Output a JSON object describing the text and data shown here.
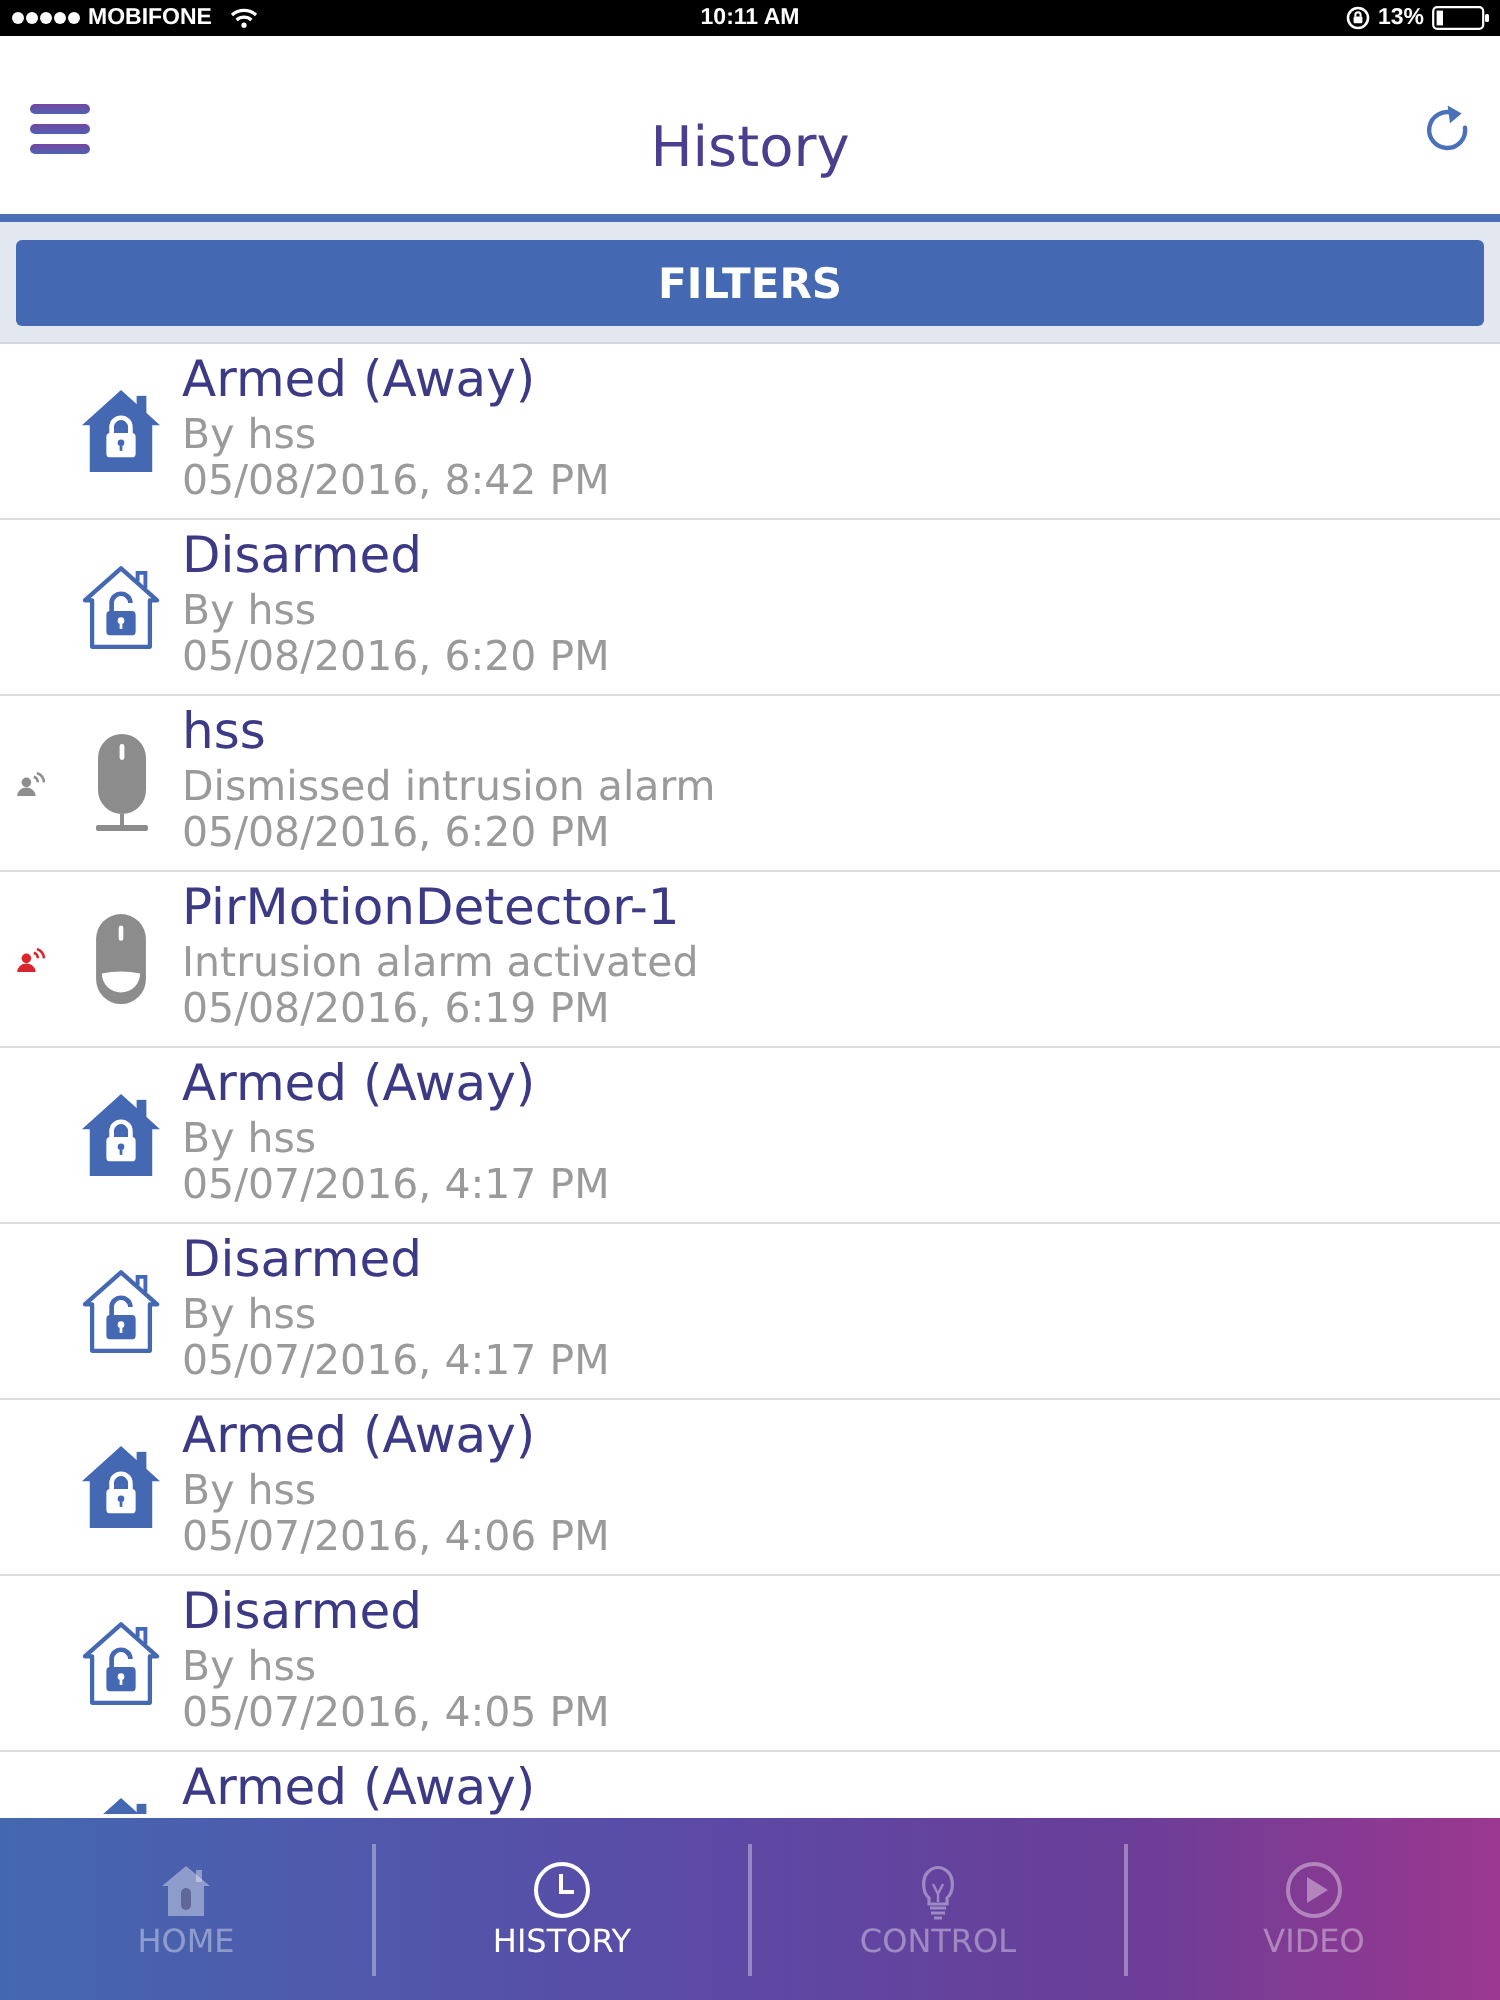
{
  "status_bar": {
    "carrier": "MOBIFONE",
    "time": "10:11 AM",
    "battery": "13%"
  },
  "header": {
    "title": "History"
  },
  "filters_button": {
    "label": "FILTERS"
  },
  "events": [
    {
      "kind": "armed",
      "title": "Armed (Away)",
      "detail": "By hss",
      "time": "05/08/2016, 8:42 PM"
    },
    {
      "kind": "disarmed",
      "title": "Disarmed",
      "detail": "By hss",
      "time": "05/08/2016, 6:20 PM"
    },
    {
      "kind": "user",
      "title": "hss",
      "detail": "Dismissed intrusion alarm",
      "time": "05/08/2016, 6:20 PM",
      "color": "#8e8e8e"
    },
    {
      "kind": "sensor",
      "title": "PirMotionDetector-1",
      "detail": "Intrusion alarm activated",
      "time": "05/08/2016, 6:19 PM",
      "color": "#d9262c"
    },
    {
      "kind": "armed",
      "title": "Armed (Away)",
      "detail": "By hss",
      "time": "05/07/2016, 4:17 PM"
    },
    {
      "kind": "disarmed",
      "title": "Disarmed",
      "detail": "By hss",
      "time": "05/07/2016, 4:17 PM"
    },
    {
      "kind": "armed",
      "title": "Armed (Away)",
      "detail": "By hss",
      "time": "05/07/2016, 4:06 PM"
    },
    {
      "kind": "disarmed",
      "title": "Disarmed",
      "detail": "By hss",
      "time": "05/07/2016, 4:05 PM"
    },
    {
      "kind": "armed",
      "title": "Armed (Away)"
    }
  ],
  "tabs": [
    {
      "label": "HOME",
      "selected": false
    },
    {
      "label": "HISTORY",
      "selected": true
    },
    {
      "label": "CONTROL",
      "selected": false
    },
    {
      "label": "VIDEO",
      "selected": false
    }
  ]
}
